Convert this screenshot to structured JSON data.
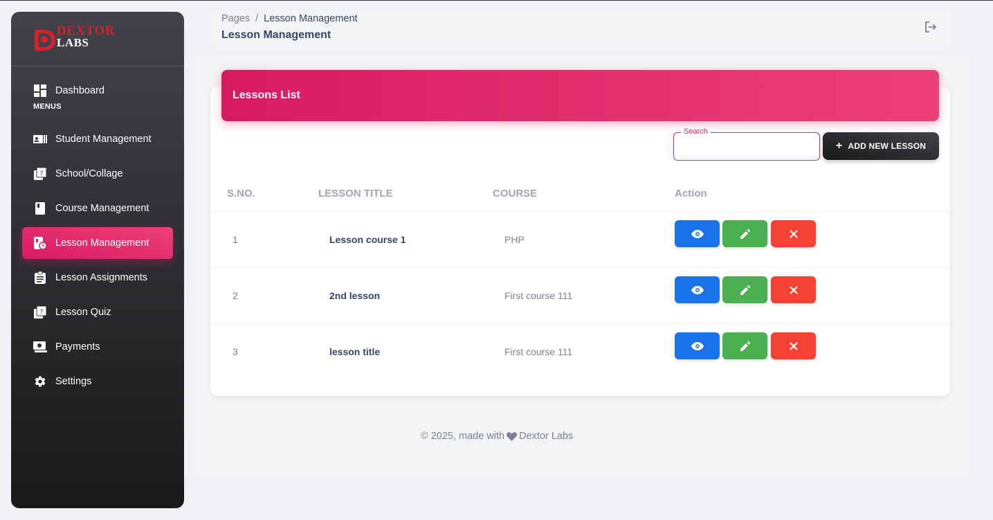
{
  "brand": {
    "line1": "DEXTOR",
    "line2": "LABS"
  },
  "sidebar": {
    "menus_label": "MENUS",
    "dashboard": "Dashboard",
    "items": [
      {
        "label": "Student Management",
        "icon": "id-card-icon"
      },
      {
        "label": "School/Collage",
        "icon": "quiz-icon"
      },
      {
        "label": "Course Management",
        "icon": "book-icon"
      },
      {
        "label": "Lesson Management",
        "icon": "lesson-icon",
        "active": true
      },
      {
        "label": "Lesson Assignments",
        "icon": "clipboard-icon"
      },
      {
        "label": "Lesson Quiz",
        "icon": "quiz-icon"
      },
      {
        "label": "Payments",
        "icon": "payments-icon"
      },
      {
        "label": "Settings",
        "icon": "gear-icon"
      }
    ]
  },
  "header": {
    "breadcrumb_root": "Pages",
    "breadcrumb_sep": "/",
    "breadcrumb_current": "Lesson Management",
    "title": "Lesson Management"
  },
  "card": {
    "title": "Lessons List",
    "search_label": "Search",
    "search_value": "",
    "add_label": "ADD NEW LESSON"
  },
  "table": {
    "columns": [
      "S.NO.",
      "LESSON TITLE",
      "COURSE",
      "Action"
    ],
    "rows": [
      {
        "sno": "1",
        "title": "Lesson course 1",
        "course": "PHP"
      },
      {
        "sno": "2",
        "title": "2nd lesson",
        "course": "First course 111"
      },
      {
        "sno": "3",
        "title": "lesson title",
        "course": "First course 111"
      }
    ]
  },
  "footer": {
    "prefix": "© 2025, made with",
    "suffix": "Dextor Labs"
  },
  "colors": {
    "accent": "#e91e63",
    "view": "#1a73e8",
    "edit": "#4caf50",
    "delete": "#f44335"
  }
}
